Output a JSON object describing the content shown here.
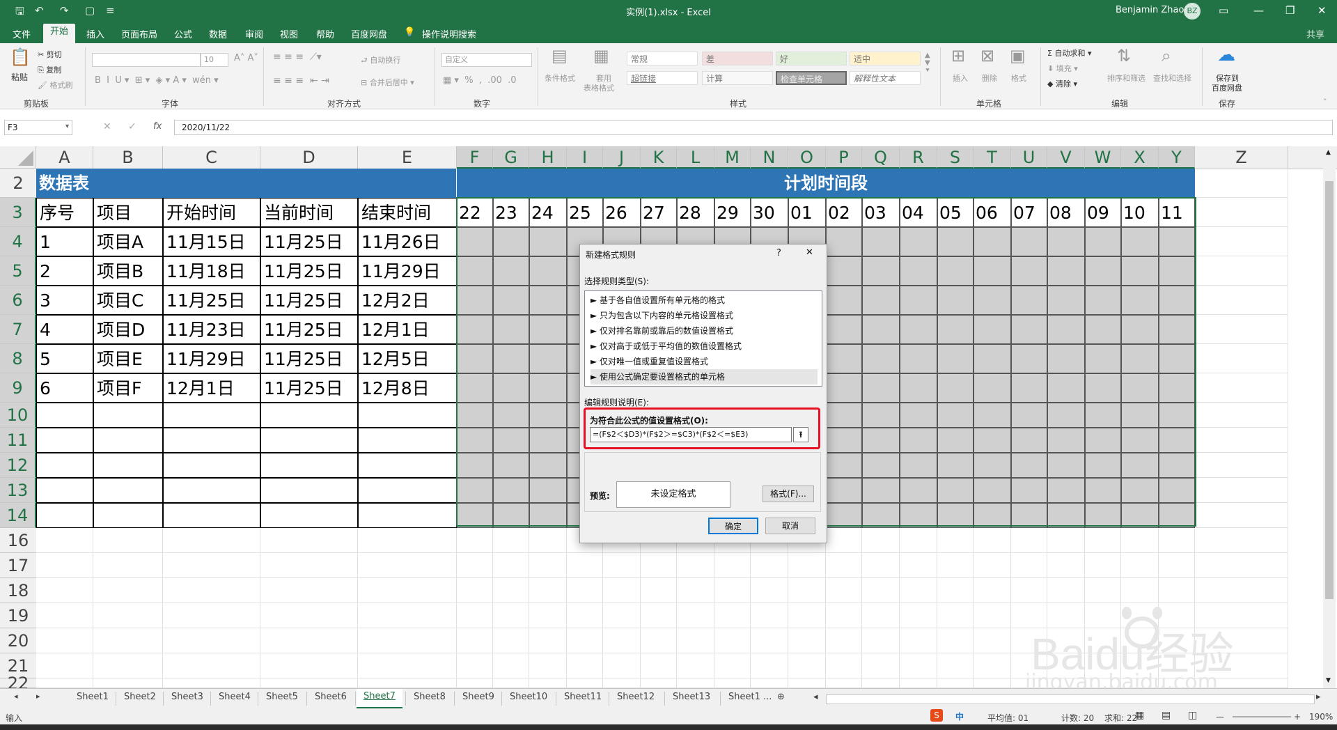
{
  "window": {
    "title": "实例(1).xlsx  -  Excel",
    "user": "Benjamin Zhao",
    "user_initials": "BZ"
  },
  "ribbon_tabs": [
    "文件",
    "开始",
    "插入",
    "页面布局",
    "公式",
    "数据",
    "审阅",
    "视图",
    "帮助",
    "百度网盘"
  ],
  "tell_me": "操作说明搜索",
  "share": "共享",
  "ribbon": {
    "clipboard": {
      "paste": "粘贴",
      "cut": "剪切",
      "copy": "复制",
      "painter": "格式刷",
      "label": "剪贴板"
    },
    "font": {
      "size": "10",
      "label": "字体"
    },
    "align": {
      "wrap": "自动换行",
      "merge": "合并后居中",
      "label": "对齐方式"
    },
    "number": {
      "format": "自定义",
      "label": "数字"
    },
    "styles": {
      "cond": "条件格式",
      "table1": "套用",
      "table2": "表格格式",
      "cells": [
        "常规",
        "差",
        "好",
        "适中",
        "超链接",
        "计算",
        "检查单元格",
        "解释性文本"
      ],
      "label": "样式"
    },
    "cells": {
      "insert": "插入",
      "delete": "删除",
      "format": "格式",
      "label": "单元格"
    },
    "editing": {
      "autosum": "自动求和",
      "fill": "填充",
      "clear": "清除",
      "sort": "排序和筛选",
      "find": "查找和选择",
      "label": "编辑"
    },
    "save": {
      "line1": "保存到",
      "line2": "百度网盘",
      "label": "保存"
    }
  },
  "formula_bar": {
    "name_box": "F3",
    "formula": "2020/11/22",
    "fx": "fx"
  },
  "columns": [
    "A",
    "B",
    "C",
    "D",
    "E",
    "F",
    "G",
    "H",
    "I",
    "J",
    "K",
    "L",
    "M",
    "N",
    "O",
    "P",
    "Q",
    "R",
    "S",
    "T",
    "U",
    "V",
    "W",
    "X",
    "Y",
    "Z"
  ],
  "rows": [
    "2",
    "3",
    "4",
    "5",
    "6",
    "7",
    "8",
    "9",
    "10",
    "11",
    "12",
    "13",
    "14",
    "16",
    "17",
    "18",
    "19",
    "20",
    "21",
    "22"
  ],
  "sheet": {
    "data_title": "数据表",
    "plan_title": "计划时间段",
    "headers": [
      "序号",
      "项目",
      "开始时间",
      "当前时间",
      "结束时间"
    ],
    "records": [
      [
        "1",
        "项目A",
        "11月15日",
        "11月25日",
        "11月26日"
      ],
      [
        "2",
        "项目B",
        "11月18日",
        "11月25日",
        "11月29日"
      ],
      [
        "3",
        "项目C",
        "11月25日",
        "11月25日",
        "12月2日"
      ],
      [
        "4",
        "项目D",
        "11月23日",
        "11月25日",
        "12月1日"
      ],
      [
        "5",
        "项目E",
        "11月29日",
        "11月25日",
        "12月5日"
      ],
      [
        "6",
        "项目F",
        "12月1日",
        "11月25日",
        "12月8日"
      ]
    ],
    "days": [
      "22",
      "23",
      "24",
      "25",
      "26",
      "27",
      "28",
      "29",
      "30",
      "01",
      "02",
      "03",
      "04",
      "05",
      "06",
      "07",
      "08",
      "09",
      "10",
      "11"
    ]
  },
  "dialog": {
    "title": "新建格式规则",
    "help": "?",
    "close": "✕",
    "select_label": "选择规则类型(S):",
    "rules": [
      "► 基于各自值设置所有单元格的格式",
      "► 只为包含以下内容的单元格设置格式",
      "► 仅对排名靠前或靠后的数值设置格式",
      "► 仅对高于或低于平均值的数值设置格式",
      "► 仅对唯一值或重复值设置格式",
      "► 使用公式确定要设置格式的单元格"
    ],
    "edit_label": "编辑规则说明(E):",
    "formula_label": "为符合此公式的值设置格式(O):",
    "formula": "=(F$2＜$D3)*(F$2＞=$C3)*(F$2＜=$E3)",
    "preview_label": "预览:",
    "preview_text": "未设定格式",
    "format_btn": "格式(F)...",
    "ok": "确定",
    "cancel": "取消"
  },
  "sheet_tabs": [
    "Sheet1",
    "Sheet2",
    "Sheet3",
    "Sheet4",
    "Sheet5",
    "Sheet6",
    "Sheet7",
    "Sheet8",
    "Sheet9",
    "Sheet10",
    "Sheet11",
    "Sheet12",
    "Sheet13",
    "Sheet1 ..."
  ],
  "active_sheet": "Sheet7",
  "status": {
    "mode": "输入",
    "ime": "中",
    "average": "平均值: 01",
    "count": "计数: 20",
    "sum": "求和: 22",
    "zoom": "190%"
  },
  "watermark": {
    "brand": "Baidu经验",
    "url": "jingyan.baidu.com"
  },
  "colors": {
    "excel_green": "#217346",
    "header_blue": "#2e75b6",
    "gantt_gray": "#d0d0d0",
    "highlight_red": "#e81123"
  }
}
